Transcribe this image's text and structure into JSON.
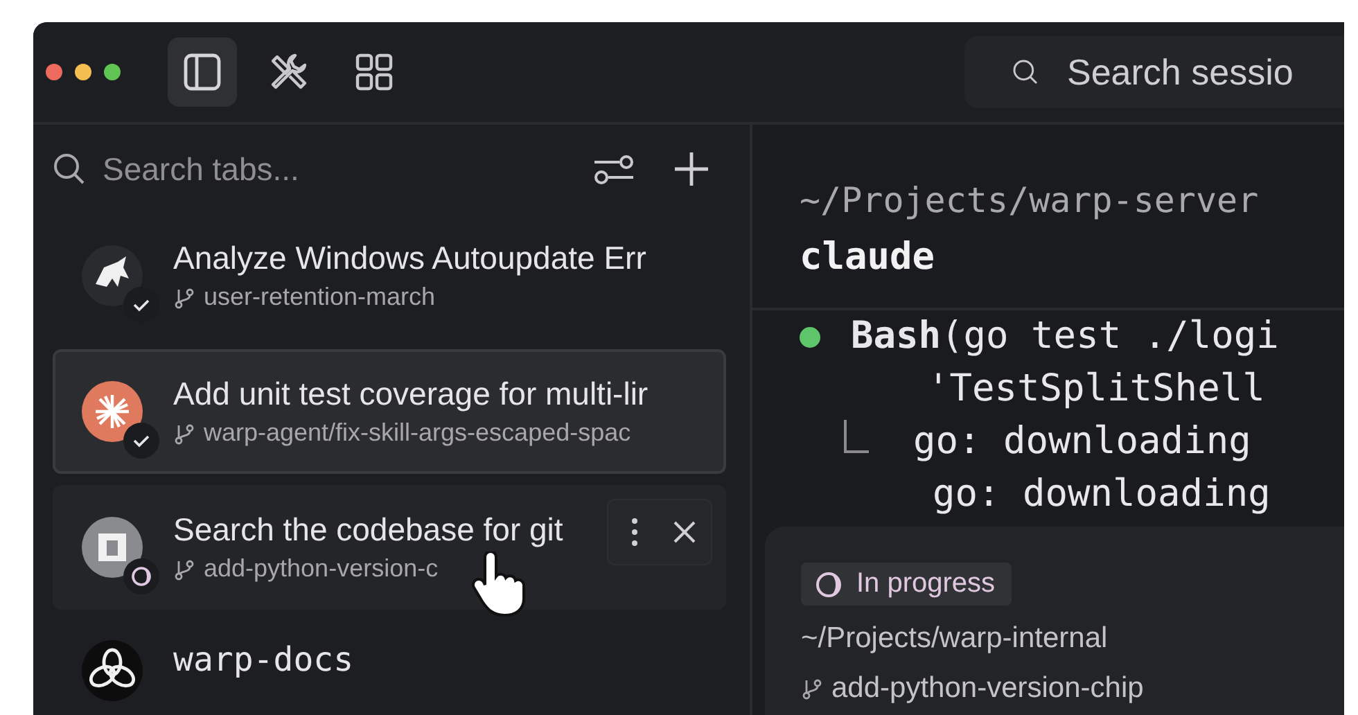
{
  "window": {
    "controls": [
      {
        "color": "#ec6a5e"
      },
      {
        "color": "#f4bf4f"
      },
      {
        "color": "#61c554"
      }
    ]
  },
  "toolbar": {
    "buttons": [
      {
        "kind": "sidebar",
        "selected": true
      },
      {
        "kind": "tools",
        "selected": false
      },
      {
        "kind": "grid",
        "selected": false
      }
    ]
  },
  "session_search": {
    "placeholder": "Search sessio"
  },
  "sidebar": {
    "search": {
      "placeholder": "Search tabs..."
    },
    "tabs": [
      {
        "kind": "agent",
        "avatar": {
          "kind": "zebra",
          "color": "#2a2b2e"
        },
        "title": "Analyze Windows Autoupdate Err",
        "branch": "user-retention-march",
        "status": {
          "kind": "done"
        },
        "selected": false,
        "hovered": false
      },
      {
        "kind": "agent",
        "avatar": {
          "kind": "burst",
          "color": "#e07a5f"
        },
        "title": "Add unit test coverage for multi-lir",
        "branch": "warp-agent/fix-skill-args-escaped-spac",
        "status": {
          "kind": "done"
        },
        "selected": true,
        "hovered": false
      },
      {
        "kind": "agent",
        "avatar": {
          "kind": "square",
          "color": "#8a8b8e"
        },
        "title": "Search the codebase for git",
        "branch": "add-python-version-c",
        "status": {
          "kind": "progress"
        },
        "selected": false,
        "hovered": true
      },
      {
        "kind": "shell",
        "avatar": {
          "kind": "knot",
          "color": "#0d0d0e"
        },
        "title": "warp-docs",
        "selected": false,
        "hovered": false
      }
    ]
  },
  "terminal": {
    "path": "~/Projects/warp-server",
    "command": "claude",
    "lines": [
      {
        "kind": "bullet",
        "text": "**Bash**(go test ./logi"
      },
      {
        "kind": "continued",
        "text": "'TestSplitShell"
      },
      {
        "kind": "branch",
        "text": "go: downloading"
      },
      {
        "kind": "output",
        "text": "go: downloading"
      }
    ]
  },
  "popup": {
    "status": "In progress",
    "path": "~/Projects/warp-internal",
    "branch": "add-python-version-chip"
  }
}
